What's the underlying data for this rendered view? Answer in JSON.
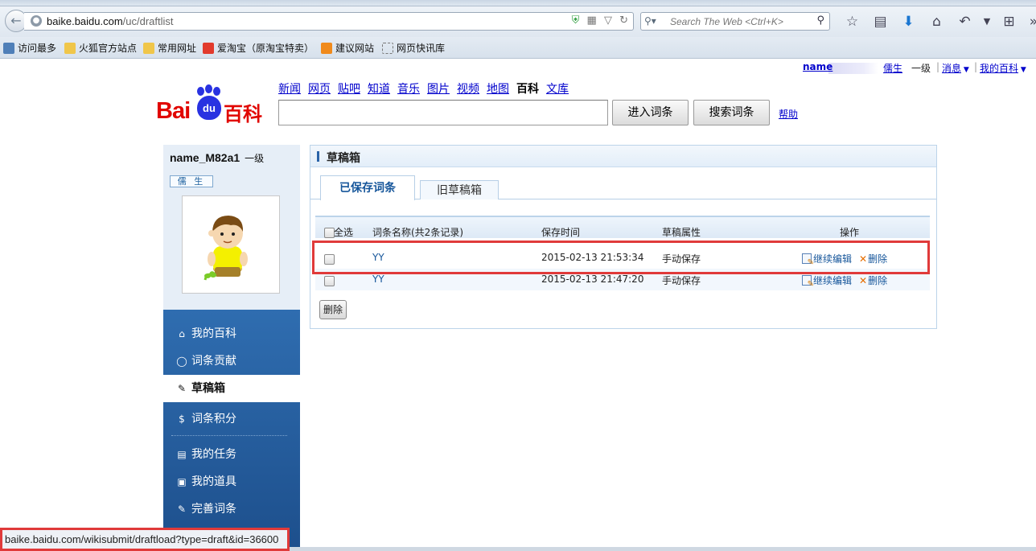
{
  "browser": {
    "url_host": "baike.baidu.com",
    "url_path": "/uc/draftlist",
    "search_placeholder": "Search The Web <Ctrl+K>",
    "bookmarks": [
      "访问最多",
      "火狐官方站点",
      "常用网址",
      "爱淘宝（原淘宝特卖）",
      "建议网站",
      "网页快讯库"
    ],
    "status_url": "baike.baidu.com/wikisubmit/draftload?type=draft&id=36600"
  },
  "userbar": {
    "name": "name",
    "rank": "儒生",
    "level": "一级",
    "messages": "消息",
    "my_baike": "我的百科",
    "sep": "|"
  },
  "logo": {
    "bai": "Bai",
    "du": "du",
    "baike": "百科"
  },
  "nav": {
    "categories": [
      "新闻",
      "网页",
      "贴吧",
      "知道",
      "音乐",
      "图片",
      "视频",
      "地图",
      "百科",
      "文库"
    ],
    "current": "百科",
    "enter_button": "进入词条",
    "search_button": "搜索词条",
    "help": "帮助"
  },
  "sidebar": {
    "username": "name_M82a1",
    "level": "一级",
    "rank_badge": "儒 生",
    "menu": [
      {
        "icon": "home-icon",
        "label": "我的百科"
      },
      {
        "icon": "bulb-icon",
        "label": "词条贡献"
      },
      {
        "icon": "draft-icon",
        "label": "草稿箱"
      },
      {
        "icon": "coin-icon",
        "label": "词条积分"
      },
      {
        "icon": "task-icon",
        "label": "我的任务"
      },
      {
        "icon": "tool-icon",
        "label": "我的道具"
      },
      {
        "icon": "improve-icon",
        "label": "完善词条"
      }
    ],
    "active": "草稿箱"
  },
  "panel": {
    "title": "草稿箱",
    "tabs": [
      "已保存词条",
      "旧草稿箱"
    ],
    "active_tab": "已保存词条",
    "columns": {
      "select_all": "全选",
      "name": "词条名称(共2条记录)",
      "time": "保存时间",
      "attr": "草稿属性",
      "ops": "操作"
    },
    "rows": [
      {
        "name": "YY",
        "time": "2015-02-13 21:53:34",
        "attr": "手动保存",
        "edit": "继续编辑",
        "delete": "删除"
      },
      {
        "name": "YY",
        "time": "2015-02-13 21:47:20",
        "attr": "手动保存",
        "edit": "继续编辑",
        "delete": "删除"
      }
    ],
    "delete_button": "删除"
  }
}
